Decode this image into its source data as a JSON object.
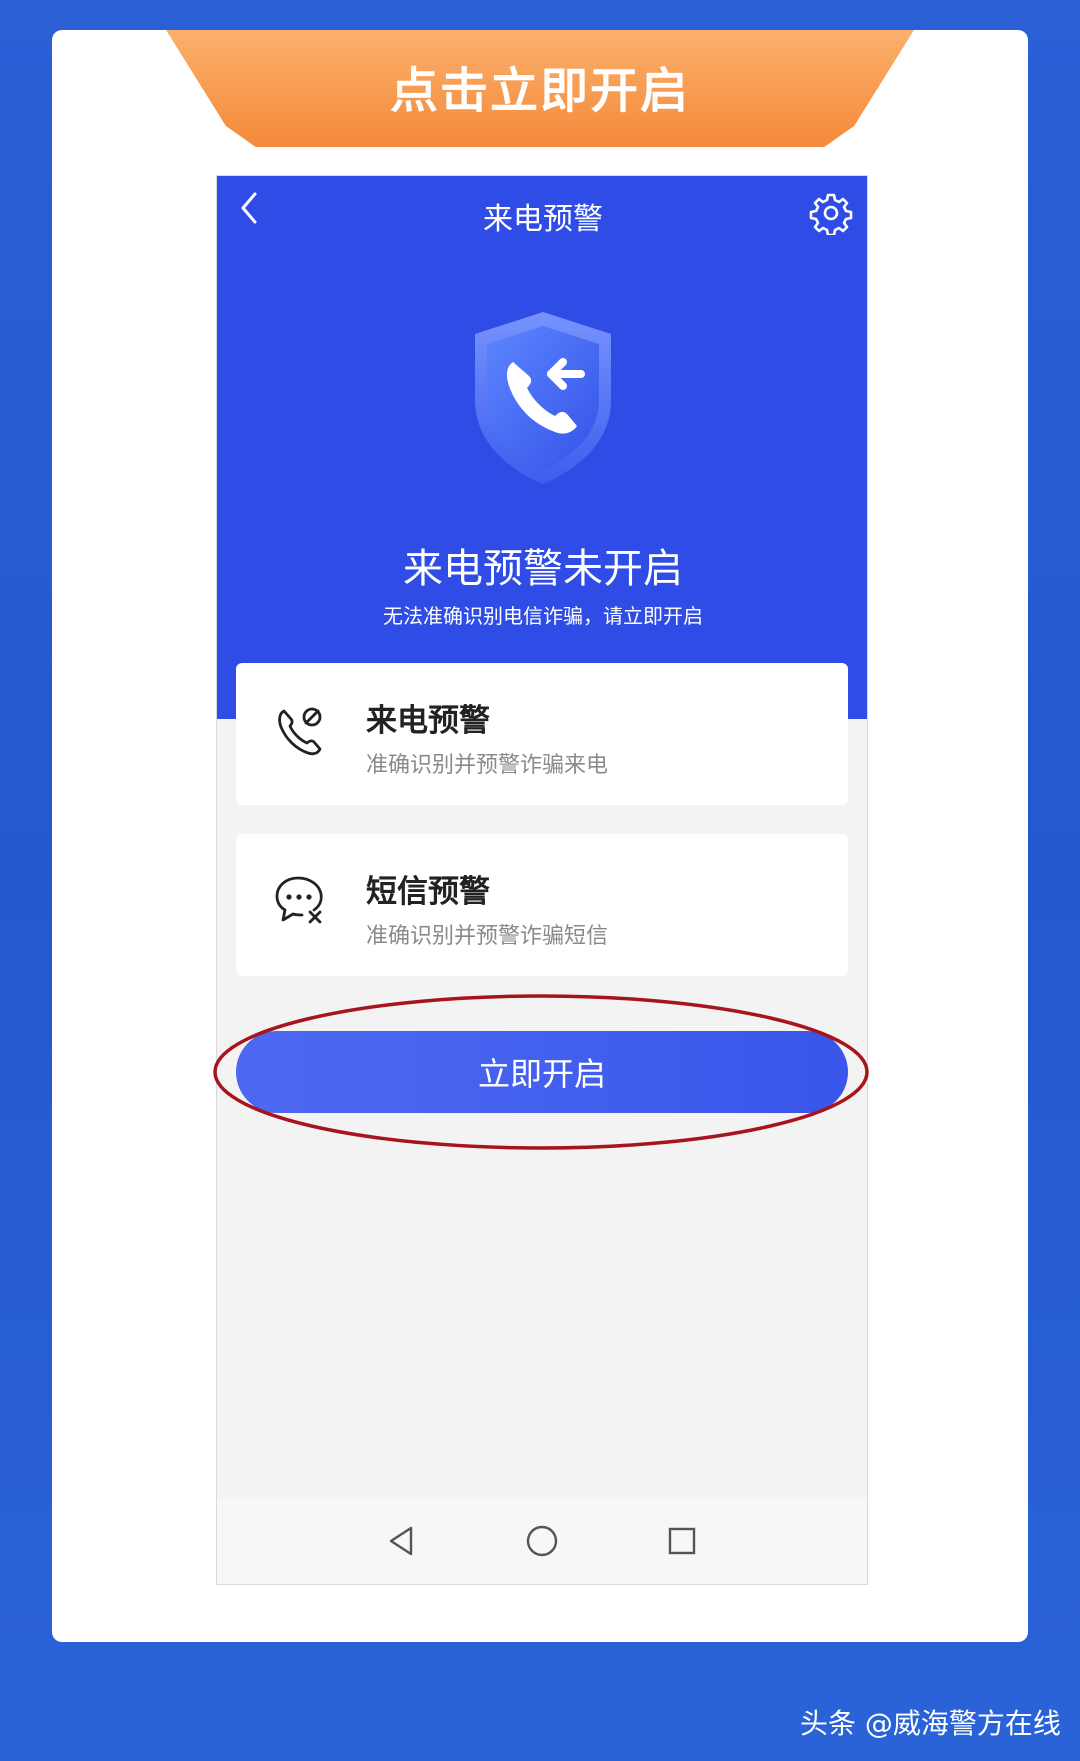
{
  "banner": {
    "title": "点击立即开启"
  },
  "app": {
    "nav_title": "来电预警",
    "status_title": "来电预警未开启",
    "status_subtitle": "无法准确识别电信诈骗，请立即开启"
  },
  "features": [
    {
      "title": "来电预警",
      "description": "准确识别并预警诈骗来电",
      "icon": "phone-warning-icon"
    },
    {
      "title": "短信预警",
      "description": "准确识别并预警诈骗短信",
      "icon": "message-block-icon"
    }
  ],
  "enable_button": {
    "label": "立即开启"
  },
  "watermark": {
    "text": "头条 @威海警方在线"
  },
  "colors": {
    "page_background": "#2359cf",
    "hero_blue": "#2f4de6",
    "button_blue": "#4361ee",
    "banner_orange": "#f48a3a",
    "highlight_red": "#a8141c"
  }
}
